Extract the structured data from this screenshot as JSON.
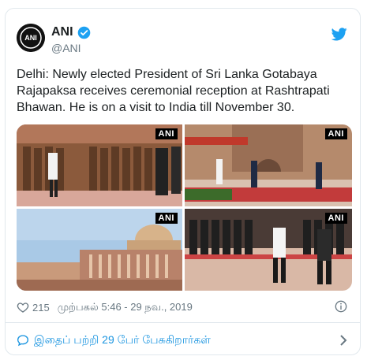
{
  "tweet": {
    "author_name": "ANI",
    "handle": "@ANI",
    "avatar_text": "ANI",
    "text": "Delhi: Newly elected President of Sri Lanka Gotabaya Rajapaksa receives ceremonial reception at Rashtrapati Bhawan. He is on a visit to India till November 30.",
    "photo_badge": "ANI",
    "likes": "215",
    "timestamp": "முற்பகல் 5:46 - 29 நவ., 2019",
    "conversation": "இதைப் பற்றி 29 பேர் பேசுகிறார்கள்"
  },
  "colors": {
    "accent": "#1b95e0",
    "muted": "#697882",
    "border": "#e1e8ed"
  },
  "icons": [
    "verified-icon",
    "twitter-bird-icon",
    "heart-icon",
    "info-icon",
    "comment-bubble-icon",
    "chevron-right-icon"
  ]
}
